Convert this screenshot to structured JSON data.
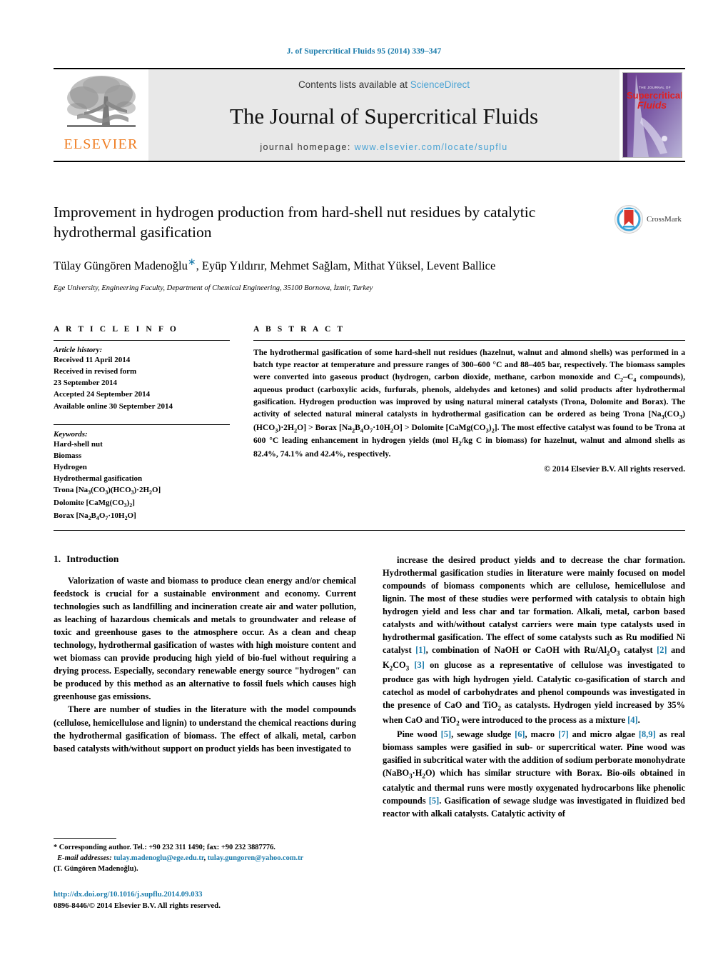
{
  "header": {
    "running_head": "J. of Supercritical Fluids 95 (2014) 339–347",
    "contents_prefix": "Contents lists available at ",
    "sciencedirect": "ScienceDirect",
    "journal_title": "The Journal of Supercritical Fluids",
    "homepage_label": "journal homepage:",
    "homepage_url": "www.elsevier.com/locate/supflu",
    "publisher_logo_text": "ELSEVIER",
    "cover_line1": "THE JOURNAL OF",
    "cover_line2": "Supercritical",
    "cover_line3": "Fluids"
  },
  "article": {
    "title": "Improvement in hydrogen production from hard-shell nut residues by catalytic hydrothermal gasification",
    "crossmark_label": "CrossMark",
    "authors": "Tülay Güngören Madenoğlu",
    "authors_rest": ", Eyüp Yıldırır, Mehmet Sağlam, Mithat Yüksel, Levent Ballice",
    "corresponding_marker": "∗",
    "affiliation": "Ege University, Engineering Faculty, Department of Chemical Engineering, 35100 Bornova, İzmir, Turkey"
  },
  "article_info": {
    "heading": "A R T I C L E    I N F O",
    "history_label": "Article history:",
    "history": [
      "Received 11 April 2014",
      "Received in revised form",
      "23 September 2014",
      "Accepted 24 September 2014",
      "Available online 30 September 2014"
    ],
    "keywords_label": "Keywords:",
    "keywords": [
      "Hard-shell nut",
      "Biomass",
      "Hydrogen",
      "Hydrothermal gasification",
      "Trona [Na3(CO3)(HCO3)·2H2O]",
      "Dolomite [CaMg(CO3)2]",
      "Borax [Na2B4O7·10H2O]"
    ]
  },
  "abstract": {
    "heading": "A B S T R A C T",
    "text": "The hydrothermal gasification of some hard-shell nut residues (hazelnut, walnut and almond shells) was performed in a batch type reactor at temperature and pressure ranges of 300–600 °C and 88–405 bar, respectively. The biomass samples were converted into gaseous product (hydrogen, carbon dioxide, methane, carbon monoxide and C2–C4 compounds), aqueous product (carboxylic acids, furfurals, phenols, aldehydes and ketones) and solid products after hydrothermal gasification. Hydrogen production was improved by using natural mineral catalysts (Trona, Dolomite and Borax). The activity of selected natural mineral catalysts in hydrothermal gasification can be ordered as being Trona [Na3(CO3)(HCO3)·2H2O] > Borax [Na2B4O7·10H2O] > Dolomite [CaMg(CO3)2]. The most effective catalyst was found to be Trona at 600 °C leading enhancement in hydrogen yields (mol H2/kg C in biomass) for hazelnut, walnut and almond shells as 82.4%, 74.1% and 42.4%, respectively.",
    "copyright": "© 2014 Elsevier B.V. All rights reserved."
  },
  "body": {
    "section_number": "1.",
    "section_title": "Introduction",
    "left_paragraphs": [
      "Valorization of waste and biomass to produce clean energy and/or chemical feedstock is crucial for a sustainable environment and economy. Current technologies such as landfilling and incineration create air and water pollution, as leaching of hazardous chemicals and metals to groundwater and release of toxic and greenhouse gases to the atmosphere occur. As a clean and cheap technology, hydrothermal gasification of wastes with high moisture content and wet biomass can provide producing high yield of bio-fuel without requiring a drying process. Especially, secondary renewable energy source \"hydrogen\" can be produced by this method as an alternative to fossil fuels which causes high greenhouse gas emissions.",
      "There are number of studies in the literature with the model compounds (cellulose, hemicellulose and lignin) to understand the chemical reactions during the hydrothermal gasification of biomass. The effect of alkali, metal, carbon based catalysts with/without support on product yields has been investigated to"
    ],
    "right_paragraph_1": "increase the desired product yields and to decrease the char formation. Hydrothermal gasification studies in literature were mainly focused on model compounds of biomass components which are cellulose, hemicellulose and lignin. The most of these studies were performed with catalysis to obtain high hydrogen yield and less char and tar formation. Alkali, metal, carbon based catalysts and with/without catalyst carriers were main type catalysts used in hydrothermal gasification. The effect of some catalysts such as Ru modified Ni catalyst [1], combination of NaOH or CaOH with Ru/Al2O3 catalyst [2] and K2CO3 [3] on glucose as a representative of cellulose was investigated to produce gas with high hydrogen yield. Catalytic co-gasification of starch and catechol as model of carbohydrates and phenol compounds was investigated in the presence of CaO and TiO2 as catalysts. Hydrogen yield increased by 35% when CaO and TiO2 were introduced to the process as a mixture [4].",
    "right_paragraph_2": "Pine wood [5], sewage sludge [6], macro [7] and micro algae [8,9] as real biomass samples were gasified in sub- or supercritical water. Pine wood was gasified in subcritical water with the addition of sodium perborate monohydrate (NaBO3·H2O) which has similar structure with Borax. Bio-oils obtained in catalytic and thermal runs were mostly oxygenated hydrocarbons like phenolic compounds [5]. Gasification of sewage sludge was investigated in fluidized bed reactor with alkali catalysts. Catalytic activity of"
  },
  "footnote": {
    "corresponding": "* Corresponding author. Tel.: +90 232 311 1490; fax: +90 232 3887776.",
    "email_label": "E-mail addresses:",
    "email1": "tulay.madenoglu@ege.edu.tr",
    "email2": "tulay.gungoren@yahoo.com.tr",
    "email_owner": "(T. Güngören Madenoğlu).",
    "doi": "http://dx.doi.org/10.1016/j.supflu.2014.09.033",
    "issn": "0896-8446/© 2014 Elsevier B.V. All rights reserved."
  },
  "colors": {
    "link_blue": "#1a7bab",
    "sciencedirect_blue": "#4aa3d4",
    "elsevier_orange": "#ef7d22"
  }
}
